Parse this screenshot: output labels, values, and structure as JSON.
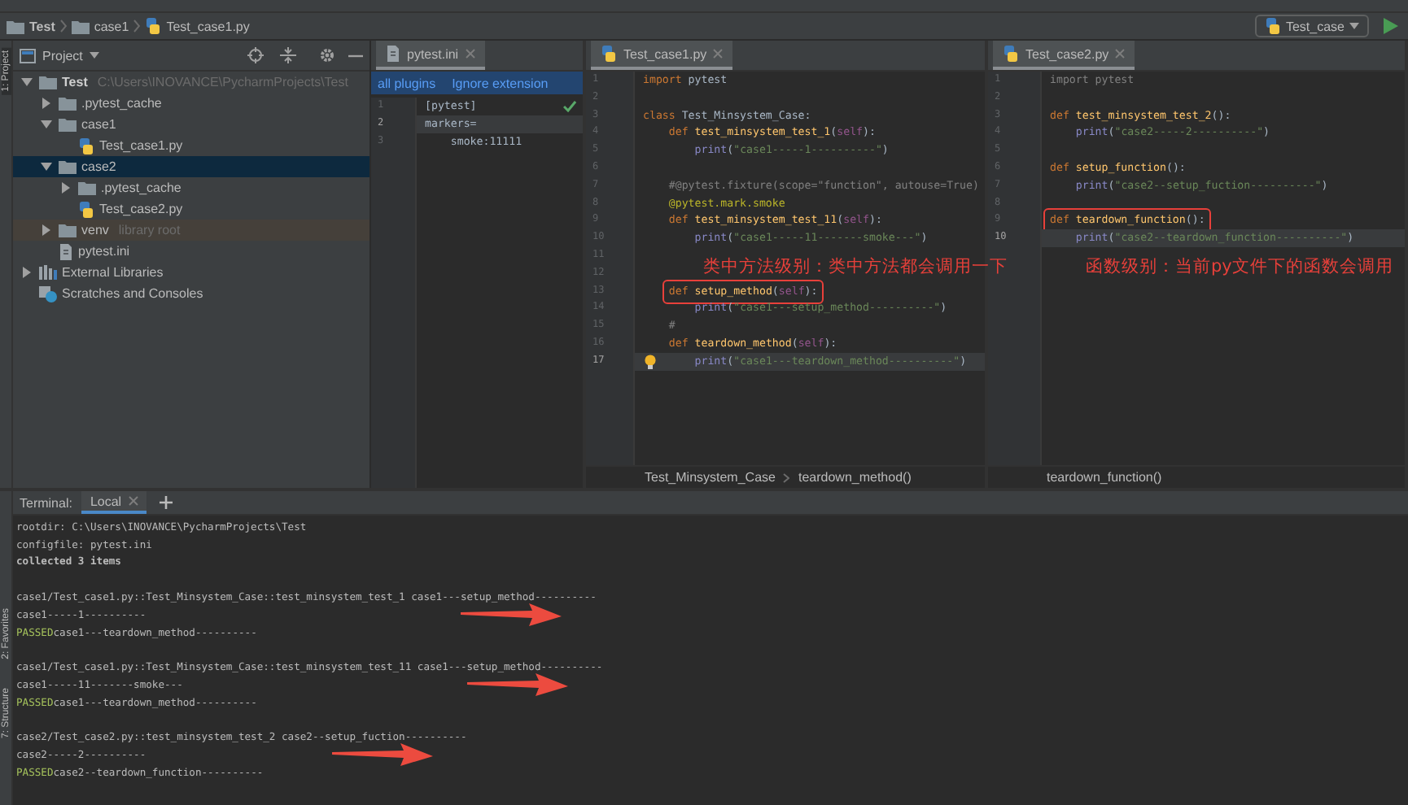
{
  "nav_bar": {
    "breadcrumbs": [
      {
        "label": "Test",
        "kind": "folder"
      },
      {
        "label": "case1",
        "kind": "folder"
      },
      {
        "label": "Test_case1.py",
        "kind": "python"
      }
    ],
    "run_config": "Test_case"
  },
  "tool_strip": {
    "top": [
      {
        "label": "1: Project",
        "selected": true
      }
    ],
    "bottom": [
      {
        "label": "2: Favorites",
        "selected": false
      },
      {
        "label": "7: Structure",
        "selected": false
      }
    ]
  },
  "project_panel": {
    "title": "Project",
    "tree": [
      {
        "name": "Test",
        "kind": "project",
        "path": "C:\\Users\\INOVANCE\\PycharmProjects\\Test",
        "expanded": true,
        "selected": false,
        "children": [
          {
            "name": ".pytest_cache",
            "kind": "folder",
            "expanded": false,
            "selected": false
          },
          {
            "name": "case1",
            "kind": "module",
            "expanded": true,
            "selected": false,
            "children": [
              {
                "name": "Test_case1.py",
                "kind": "python",
                "selected": false
              }
            ]
          },
          {
            "name": "case2",
            "kind": "module",
            "expanded": true,
            "selected": true,
            "children": [
              {
                "name": ".pytest_cache",
                "kind": "folder",
                "expanded": false,
                "selected": false
              },
              {
                "name": "Test_case2.py",
                "kind": "python",
                "selected": false
              }
            ]
          },
          {
            "name": "venv",
            "kind": "library",
            "note": "library root",
            "expanded": false,
            "selected": false
          },
          {
            "name": "pytest.ini",
            "kind": "ini",
            "selected": false
          }
        ]
      },
      {
        "name": "External Libraries",
        "kind": "libraries",
        "expanded": false,
        "selected": false
      },
      {
        "name": "Scratches and Consoles",
        "kind": "scratches",
        "selected": false
      }
    ]
  },
  "editors": [
    {
      "tab": {
        "label": "pytest.ini",
        "kind": "ini",
        "selected": true
      },
      "banner": {
        "links": [
          "all plugins",
          "Ignore extension"
        ]
      },
      "lines": [
        {
          "n": "1",
          "current": false,
          "check": true,
          "tokens": [
            {
              "kind": "plain",
              "text": "[pytest]"
            }
          ]
        },
        {
          "n": "2",
          "current": true,
          "tokens": [
            {
              "kind": "plain",
              "text": "markers="
            }
          ]
        },
        {
          "n": "3",
          "current": false,
          "tokens": [
            {
              "kind": "plain",
              "text": "    smoke:11111"
            }
          ]
        }
      ]
    },
    {
      "tab": {
        "label": "Test_case1.py",
        "kind": "python",
        "selected": true
      },
      "annotation": "类中方法级别：类中方法都会调用一下",
      "breadcrumbs": [
        "Test_Minsystem_Case",
        "teardown_method()"
      ],
      "lines": [
        {
          "n": "1",
          "current": false,
          "tokens": [
            {
              "kind": "kw",
              "text": "import "
            },
            {
              "kind": "plain",
              "text": "pytest"
            }
          ]
        },
        {
          "n": "2",
          "current": false
        },
        {
          "n": "3",
          "current": false,
          "tokens": [
            {
              "kind": "kw",
              "text": "class "
            },
            {
              "kind": "plain",
              "text": "Test_Minsystem_Case:"
            }
          ]
        },
        {
          "n": "4",
          "current": false,
          "tokens": [
            {
              "kind": "kw",
              "text": "    def "
            },
            {
              "kind": "fn",
              "text": "test_minsystem_test_1"
            },
            {
              "kind": "plain",
              "text": "("
            },
            {
              "kind": "self",
              "text": "self"
            },
            {
              "kind": "plain",
              "text": "):"
            }
          ]
        },
        {
          "n": "5",
          "current": false,
          "tokens": [
            {
              "kind": "builtin",
              "text": "        print"
            },
            {
              "kind": "plain",
              "text": "("
            },
            {
              "kind": "string",
              "text": "\"case1-----1----------\""
            },
            {
              "kind": "plain",
              "text": ")"
            }
          ]
        },
        {
          "n": "6",
          "current": false
        },
        {
          "n": "7",
          "current": false,
          "tokens": [
            {
              "kind": "comment",
              "text": "    #@pytest.fixture(scope=\"function\", autouse=True)"
            }
          ]
        },
        {
          "n": "8",
          "current": false,
          "tokens": [
            {
              "kind": "deco",
              "text": "    @pytest.mark.smoke"
            }
          ]
        },
        {
          "n": "9",
          "current": false,
          "tokens": [
            {
              "kind": "kw",
              "text": "    def "
            },
            {
              "kind": "fn",
              "text": "test_minsystem_test_11"
            },
            {
              "kind": "plain",
              "text": "("
            },
            {
              "kind": "self",
              "text": "self"
            },
            {
              "kind": "plain",
              "text": "):"
            }
          ]
        },
        {
          "n": "10",
          "current": false,
          "tokens": [
            {
              "kind": "builtin",
              "text": "        print"
            },
            {
              "kind": "plain",
              "text": "("
            },
            {
              "kind": "string",
              "text": "\"case1-----11-------smoke---\""
            },
            {
              "kind": "plain",
              "text": ")"
            }
          ]
        },
        {
          "n": "11",
          "current": false
        },
        {
          "n": "12",
          "current": false
        },
        {
          "n": "13",
          "current": false,
          "boxed": true,
          "tokens": [
            {
              "kind": "kw",
              "text": "    def "
            },
            {
              "kind": "fn",
              "text": "setup_method"
            },
            {
              "kind": "plain",
              "text": "("
            },
            {
              "kind": "self",
              "text": "self"
            },
            {
              "kind": "plain",
              "text": "):"
            }
          ]
        },
        {
          "n": "14",
          "current": false,
          "tokens": [
            {
              "kind": "builtin",
              "text": "        print"
            },
            {
              "kind": "plain",
              "text": "("
            },
            {
              "kind": "string",
              "text": "\"case1---setup_method----------\""
            },
            {
              "kind": "plain",
              "text": ")"
            }
          ]
        },
        {
          "n": "15",
          "current": false,
          "tokens": [
            {
              "kind": "comment",
              "text": "    #"
            }
          ]
        },
        {
          "n": "16",
          "current": false,
          "tokens": [
            {
              "kind": "kw",
              "text": "    def "
            },
            {
              "kind": "fn",
              "text": "teardown_method"
            },
            {
              "kind": "plain",
              "text": "("
            },
            {
              "kind": "self",
              "text": "self"
            },
            {
              "kind": "plain",
              "text": "):"
            }
          ]
        },
        {
          "n": "17",
          "current": true,
          "bulb": true,
          "tokens": [
            {
              "kind": "builtin",
              "text": "        print"
            },
            {
              "kind": "plain",
              "text": "("
            },
            {
              "kind": "string",
              "text": "\"case1---teardown_method----------\""
            },
            {
              "kind": "plain",
              "text": ")"
            }
          ]
        }
      ]
    },
    {
      "tab": {
        "label": "Test_case2.py",
        "kind": "python",
        "selected": true
      },
      "annotation": "函数级别：当前py文件下的函数会调用",
      "breadcrumbs": [
        "teardown_function()"
      ],
      "lines": [
        {
          "n": "1",
          "current": false,
          "tokens": [
            {
              "kind": "comment",
              "text": "import pytest"
            }
          ]
        },
        {
          "n": "2",
          "current": false
        },
        {
          "n": "3",
          "current": false,
          "tokens": [
            {
              "kind": "kw",
              "text": "def "
            },
            {
              "kind": "fn",
              "text": "test_minsystem_test_2"
            },
            {
              "kind": "plain",
              "text": "():"
            }
          ]
        },
        {
          "n": "4",
          "current": false,
          "tokens": [
            {
              "kind": "builtin",
              "text": "    print"
            },
            {
              "kind": "plain",
              "text": "("
            },
            {
              "kind": "string",
              "text": "\"case2-----2----------\""
            },
            {
              "kind": "plain",
              "text": ")"
            }
          ]
        },
        {
          "n": "5",
          "current": false
        },
        {
          "n": "6",
          "current": false,
          "tokens": [
            {
              "kind": "kw",
              "text": "def "
            },
            {
              "kind": "fn",
              "text": "setup_function"
            },
            {
              "kind": "plain",
              "text": "():"
            }
          ]
        },
        {
          "n": "7",
          "current": false,
          "tokens": [
            {
              "kind": "builtin",
              "text": "    print"
            },
            {
              "kind": "plain",
              "text": "("
            },
            {
              "kind": "string",
              "text": "\"case2--setup_fuction----------\""
            },
            {
              "kind": "plain",
              "text": ")"
            }
          ]
        },
        {
          "n": "8",
          "current": false
        },
        {
          "n": "9",
          "current": false,
          "boxed": true,
          "tokens": [
            {
              "kind": "kw",
              "text": "def "
            },
            {
              "kind": "fn",
              "text": "teardown_function"
            },
            {
              "kind": "plain",
              "text": "():"
            }
          ]
        },
        {
          "n": "10",
          "current": true,
          "tokens": [
            {
              "kind": "builtin",
              "text": "    print"
            },
            {
              "kind": "plain",
              "text": "("
            },
            {
              "kind": "string",
              "text": "\"case2--teardown_function----------\""
            },
            {
              "kind": "plain",
              "text": ")"
            }
          ]
        }
      ]
    }
  ],
  "terminal": {
    "title": "Terminal:",
    "tabs": [
      {
        "label": "Local",
        "selected": true
      }
    ],
    "lines": [
      {
        "kind": "plain",
        "text": "rootdir: C:\\Users\\INOVANCE\\PycharmProjects\\Test"
      },
      {
        "kind": "plain",
        "text": "configfile: pytest.ini"
      },
      {
        "kind": "bold",
        "text": "collected 3 items"
      },
      {
        "kind": "blank"
      },
      {
        "kind": "plain",
        "text": "case1/Test_case1.py::Test_Minsystem_Case::test_minsystem_test_1 case1---setup_method----------"
      },
      {
        "kind": "plain",
        "arrow": true,
        "text": "case1-----1----------"
      },
      {
        "kind": "passed",
        "status": "PASSED",
        "text": "case1---teardown_method----------"
      },
      {
        "kind": "blank"
      },
      {
        "kind": "plain",
        "text": "case1/Test_case1.py::Test_Minsystem_Case::test_minsystem_test_11 case1---setup_method----------"
      },
      {
        "kind": "plain",
        "arrow": true,
        "text": "case1-----11-------smoke---"
      },
      {
        "kind": "passed",
        "status": "PASSED",
        "text": "case1---teardown_method----------"
      },
      {
        "kind": "blank"
      },
      {
        "kind": "plain",
        "text": "case2/Test_case2.py::test_minsystem_test_2 case2--setup_fuction----------"
      },
      {
        "kind": "plain",
        "arrow": true,
        "text": "case2-----2----------"
      },
      {
        "kind": "passed",
        "status": "PASSED",
        "text": "case2--teardown_function----------"
      }
    ]
  }
}
